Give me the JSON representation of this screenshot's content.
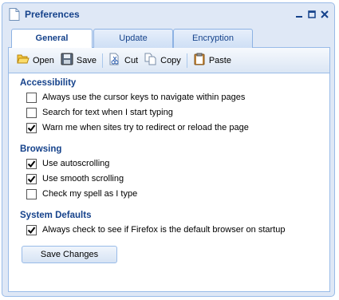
{
  "window": {
    "title": "Preferences"
  },
  "tabs": [
    {
      "label": "General",
      "active": true
    },
    {
      "label": "Update",
      "active": false
    },
    {
      "label": "Encryption",
      "active": false
    }
  ],
  "toolbar": {
    "open": "Open",
    "save": "Save",
    "cut": "Cut",
    "copy": "Copy",
    "paste": "Paste"
  },
  "sections": {
    "accessibility": {
      "title": "Accessibility",
      "items": [
        {
          "label": "Always use the cursor keys to navigate within pages",
          "checked": false
        },
        {
          "label": "Search for text when I start typing",
          "checked": false
        },
        {
          "label": "Warn me when sites try to redirect or reload the page",
          "checked": true
        }
      ]
    },
    "browsing": {
      "title": "Browsing",
      "items": [
        {
          "label": "Use autoscrolling",
          "checked": true
        },
        {
          "label": "Use smooth scrolling",
          "checked": true
        },
        {
          "label": "Check my spell as I type",
          "checked": false
        }
      ]
    },
    "system": {
      "title": "System Defaults",
      "items": [
        {
          "label": "Always check to see if Firefox is the default browser on startup",
          "checked": true
        }
      ]
    }
  },
  "save_button": "Save Changes",
  "colors": {
    "accent": "#15428b",
    "window_bg": "#dfe8f6",
    "border": "#99bbe8"
  }
}
